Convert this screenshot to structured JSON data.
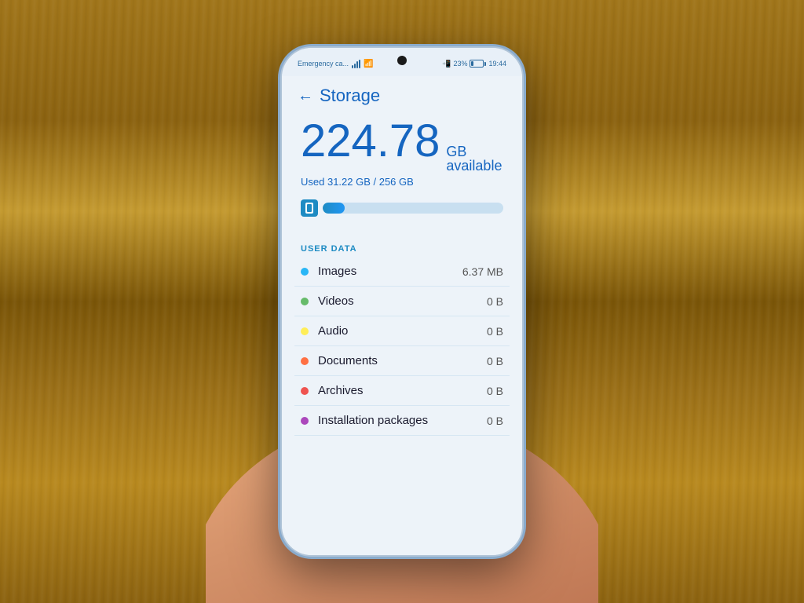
{
  "background": {
    "color": "#8B6914"
  },
  "status_bar": {
    "left_text": "Emergency ca...",
    "battery_percent": "23%",
    "time": "19:44"
  },
  "header": {
    "back_label": "←",
    "title": "Storage"
  },
  "storage": {
    "available_number": "224.78",
    "available_unit": "GB available",
    "used_label": "Used 31.22 GB / 256 GB",
    "progress_percent": 12.2
  },
  "section": {
    "label": "USER DATA"
  },
  "data_items": [
    {
      "name": "Images",
      "size": "6.37 MB",
      "dot_color": "#29b6f6"
    },
    {
      "name": "Videos",
      "size": "0 B",
      "dot_color": "#66bb6a"
    },
    {
      "name": "Audio",
      "size": "0 B",
      "dot_color": "#ffee58"
    },
    {
      "name": "Documents",
      "size": "0 B",
      "dot_color": "#ff7043"
    },
    {
      "name": "Archives",
      "size": "0 B",
      "dot_color": "#ef5350"
    },
    {
      "name": "Installation packages",
      "size": "0 B",
      "dot_color": "#ab47bc"
    }
  ]
}
